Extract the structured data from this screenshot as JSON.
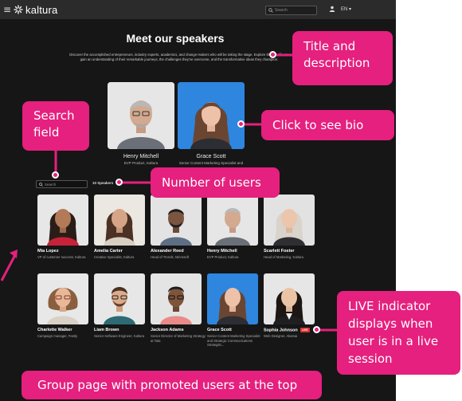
{
  "topbar": {
    "menu_glyph": "≡",
    "logo_text": "kaltura",
    "search_placeholder": "Search",
    "lang": "EN ▾"
  },
  "page": {
    "title": "Meet our speakers",
    "description": "Discover the accomplished entrepreneurs, industry experts, academics, and change-makers who will be taking the stage. Explore their profiles to gain an understanding of their remarkable journeys, the challenges they've overcome, and the transformative ideas they champion."
  },
  "promoted": [
    {
      "name": "Henry Mitchell",
      "role": "EVP Product, Kaltura"
    },
    {
      "name": "Grace Scott",
      "role": "Senior Content Marketing Specialist and"
    }
  ],
  "grid_controls": {
    "search_placeholder": "Search",
    "count": "10 Speakers"
  },
  "speakers": [
    {
      "name": "Mia Lopez",
      "role": "VP of customer success, Kaltura"
    },
    {
      "name": "Amelia Carter",
      "role": "Creative Specialist, Kaltura"
    },
    {
      "name": "Alexander Reed",
      "role": "Head of Trends, Microsoft"
    },
    {
      "name": "Henry Mitchell",
      "role": "EVP Product, Kaltura"
    },
    {
      "name": "Scarlett Foster",
      "role": "Head of Marketing, Kaltura"
    },
    {
      "name": "Charlotte Walker",
      "role": "Campaign manager, Fastly"
    },
    {
      "name": "Liam Brown",
      "role": "Senior Software Engineer, Kaltura"
    },
    {
      "name": "Jackson Adams",
      "role": "Senior Director of Marketing Strategy at Tata"
    },
    {
      "name": "Grace Scott",
      "role": "Senior Content Marketing Specialist and Strategic Communications Strategist..."
    },
    {
      "name": "Sophia Johnson",
      "role": "Web Designer, Akamai",
      "live": "LIVE"
    }
  ],
  "callouts": {
    "title_desc": "Title and description",
    "bio": "Click to see bio",
    "search": "Search field",
    "users": "Number of users",
    "live": "LIVE indicator displays when user is in a live session",
    "group": "Group page with promoted users at the top"
  },
  "colors": {
    "accent": "#e5207e",
    "background": "#161616",
    "topbar": "#2b2b2b",
    "live": "#d93131"
  },
  "icons": [
    "menu-icon",
    "kaltura-logo-icon",
    "search-icon",
    "user-icon"
  ]
}
